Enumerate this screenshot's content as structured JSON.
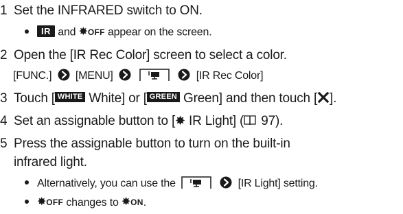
{
  "steps": [
    {
      "number": "1",
      "text": "Set the INFRARED switch to ON.",
      "bullet": {
        "ir_badge": "IR",
        "and_word": "and",
        "bug_off": "OFF",
        "rest": "appear on the screen."
      }
    },
    {
      "number": "2",
      "text": "Open the [IR Rec Color] screen to select a color.",
      "path": {
        "func": "[FUNC.]",
        "menu": "[MENU]",
        "end": "[IR Rec Color]"
      }
    },
    {
      "number": "3",
      "pre": "Touch [",
      "white_badge": "WHITE",
      "white_text": " White] or [",
      "green_badge": "GREEN",
      "green_text": " Green] and then touch [",
      "post": "]."
    },
    {
      "number": "4",
      "pre": "Set an assignable button to [",
      "mid": " IR Light] (",
      "page_ref": " 97",
      "post": ")."
    },
    {
      "number": "5",
      "line1": "Press the assignable button to turn on the built-in",
      "line2": "infrared light.",
      "bullets": [
        {
          "pre": "Alternatively, you can use the",
          "post": "[IR Light] setting."
        },
        {
          "bug_off": "OFF",
          "mid": " changes to ",
          "bug_on": "ON",
          "post": "."
        }
      ]
    }
  ],
  "icons": {
    "bug": "✸",
    "arrow": "right-arrow-icon",
    "camera": "camera-menu-icon",
    "close": "x-icon",
    "book": "book-icon"
  }
}
